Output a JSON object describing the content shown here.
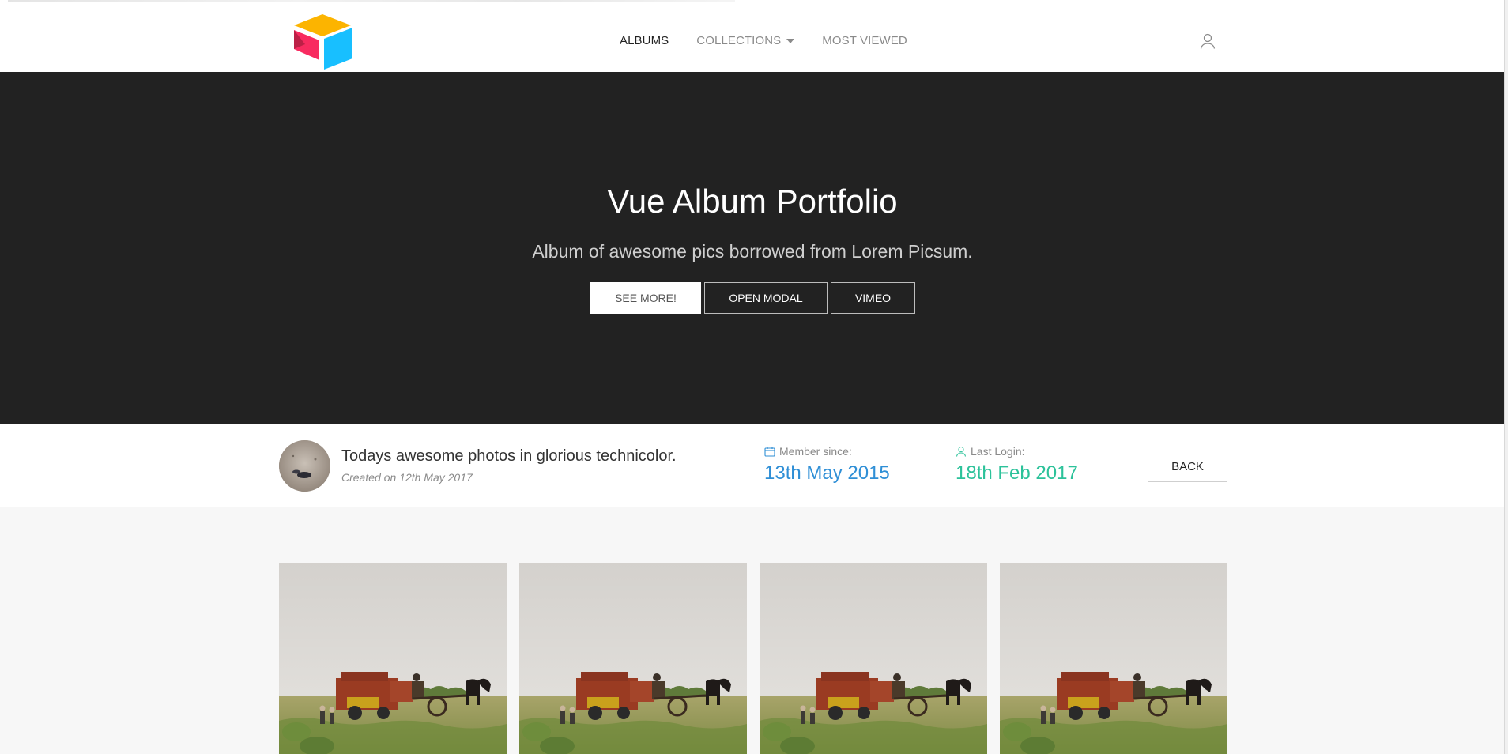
{
  "nav": {
    "items": [
      {
        "label": "ALBUMS"
      },
      {
        "label": "COLLECTIONS"
      },
      {
        "label": "MOST VIEWED"
      }
    ]
  },
  "hero": {
    "title": "Vue Album Portfolio",
    "subtitle": "Album of awesome pics borrowed from Lorem Picsum.",
    "buttons": {
      "see_more": "SEE MORE!",
      "open_modal": "OPEN MODAL",
      "vimeo": "VIMEO"
    }
  },
  "album": {
    "title": "Todays awesome photos in glorious technicolor.",
    "created": "Created on 12th May 2017",
    "member_since_label": "Member since:",
    "member_since_value": "13th May 2015",
    "last_login_label": "Last Login:",
    "last_login_value": "18th Feb 2017",
    "back_label": "BACK"
  },
  "gallery": {
    "photos": [
      {
        "icon": "harvest-photo"
      },
      {
        "icon": "harvest-photo"
      },
      {
        "icon": "harvest-photo"
      },
      {
        "icon": "harvest-photo"
      }
    ]
  },
  "colors": {
    "hero_bg": "#222222",
    "member_since": "#2f8fd6",
    "last_login": "#2cc29a",
    "logo_yellow": "#fcb400",
    "logo_blue": "#18bfff",
    "logo_red": "#f82b60"
  }
}
